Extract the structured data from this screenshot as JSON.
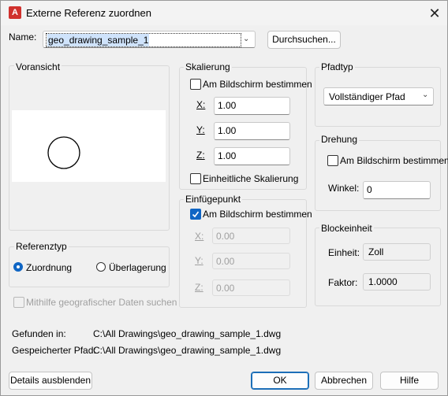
{
  "window": {
    "title": "Externe Referenz zuordnen",
    "app_icon": "A"
  },
  "name": {
    "label": "Name:",
    "value": "geo_drawing_sample_1",
    "browse_button": "Durchsuchen..."
  },
  "preview": {
    "label": "Voransicht"
  },
  "scaling": {
    "label": "Skalierung",
    "on_screen": "Am Bildschirm bestimmen",
    "x_label": "X:",
    "x_value": "1.00",
    "y_label": "Y:",
    "y_value": "1.00",
    "z_label": "Z:",
    "z_value": "1.00",
    "uniform": "Einheitliche Skalierung"
  },
  "path_type": {
    "label": "Pfadtyp",
    "selected": "Vollständiger Pfad"
  },
  "rotation": {
    "label": "Drehung",
    "on_screen": "Am Bildschirm bestimmen",
    "angle_label": "Winkel:",
    "angle_value": "0"
  },
  "reference_type": {
    "label": "Referenztyp",
    "attachment": "Zuordnung",
    "overlay": "Überlagerung"
  },
  "insertion_point": {
    "label": "Einfügepunkt",
    "on_screen": "Am Bildschirm bestimmen",
    "x_label": "X:",
    "x_value": "0.00",
    "y_label": "Y:",
    "y_value": "0.00",
    "z_label": "Z:",
    "z_value": "0.00"
  },
  "block_unit": {
    "label": "Blockeinheit",
    "unit_label": "Einheit:",
    "unit_value": "Zoll",
    "factor_label": "Faktor:",
    "factor_value": "1.0000"
  },
  "geo": {
    "label": "Mithilfe geografischer Daten suchen"
  },
  "found_in": {
    "label": "Gefunden in:",
    "value": "C:\\All Drawings\\geo_drawing_sample_1.dwg"
  },
  "saved_path": {
    "label": "Gespeicherter Pfad:",
    "value": "C:\\All Drawings\\geo_drawing_sample_1.dwg"
  },
  "buttons": {
    "details": "Details ausblenden",
    "ok": "OK",
    "cancel": "Abbrechen",
    "help": "Hilfe"
  },
  "colors": {
    "accent": "#0f65c4",
    "app_icon": "#d0312d"
  }
}
